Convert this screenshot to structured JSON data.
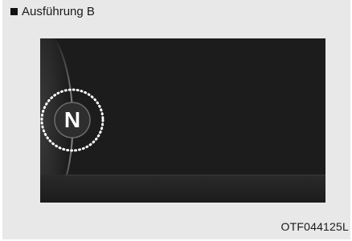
{
  "figure": {
    "caption": "Ausführung B",
    "caption_marker": "square-bullet-icon",
    "gear_indicator": "N",
    "reference_code": "OTF044125L"
  },
  "colors": {
    "panel_background": "#e8e8e8",
    "screen_background": "#1c1c1c",
    "indicator_text": "#ffffff",
    "dotted_ring": "#ffffff"
  }
}
